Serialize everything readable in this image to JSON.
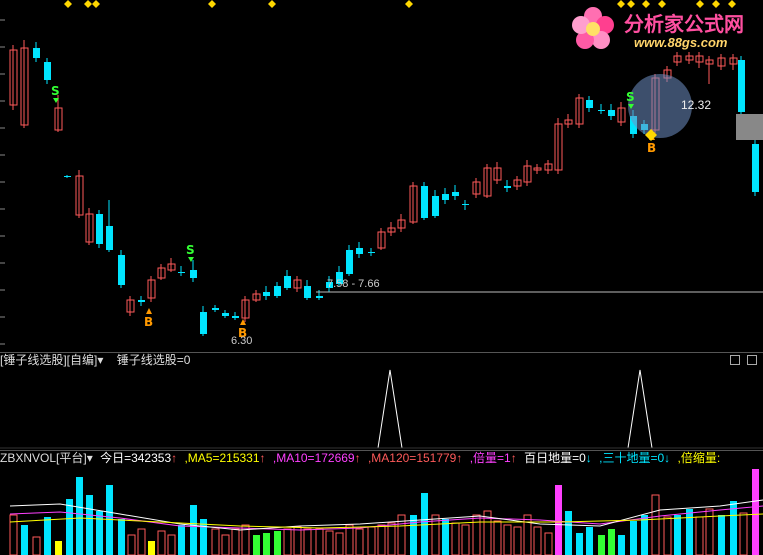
{
  "main_chart": {
    "high_label": "12.32",
    "low_label": "6.30",
    "range_label": "7.58 - 7.66",
    "signal_s": "S",
    "signal_b": "B"
  },
  "logo": {
    "text": "分析家公式网",
    "url": "www.88gs.com"
  },
  "indicator_panel": {
    "name": "[锤子线选股][自编]",
    "dropdown": "▾",
    "value_label": "锤子线选股=0"
  },
  "volume_panel": {
    "name": "ZBXNVOL[平台]",
    "dropdown": "▾",
    "today": "今日=342353",
    "ma5": ",MA5=215331",
    "ma10": ",MA10=172669",
    "ma120": ",MA120=151779",
    "beiliang": ",倍量=1",
    "bairi": "百日地量=0",
    "sanshi": ",三十地量=0",
    "beisuo": ",倍缩量:",
    "arrow_up": "↑",
    "arrow_down": "↓"
  },
  "colors": {
    "up": "#ff5a5a",
    "down": "#00e5ff",
    "ma5": "#ffffff",
    "ma10": "#ffff00",
    "ma120": "#ff40ff",
    "signal_s": "#33ff33",
    "signal_b": "#ff9900"
  }
}
